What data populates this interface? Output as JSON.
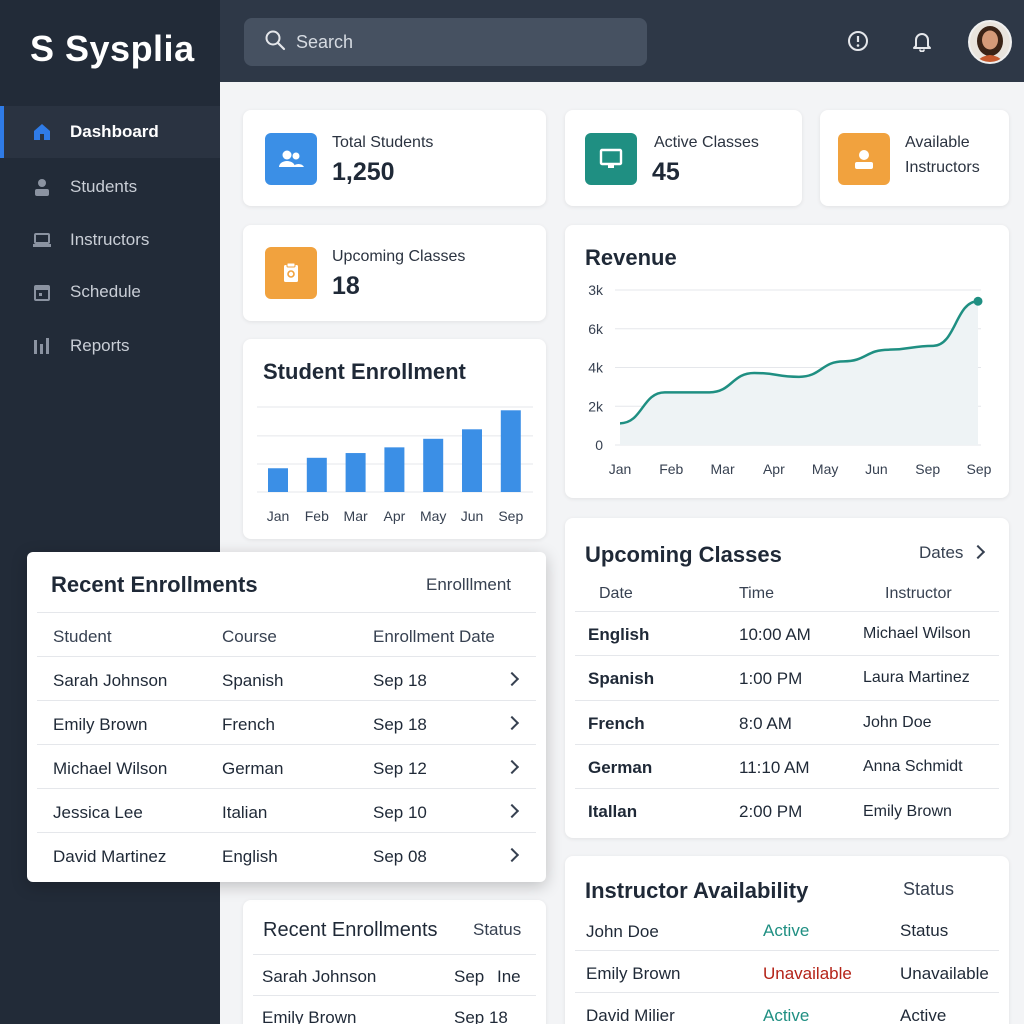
{
  "brand": "S Sysplia",
  "sidebar": {
    "items": [
      {
        "label": "Dashboard",
        "icon": "home-icon"
      },
      {
        "label": "Students",
        "icon": "user-icon"
      },
      {
        "label": "Instructors",
        "icon": "laptop-icon"
      },
      {
        "label": "Schedule",
        "icon": "calendar-icon"
      },
      {
        "label": "Reports",
        "icon": "bar-chart-icon"
      }
    ]
  },
  "header": {
    "search_placeholder": "Search"
  },
  "stats": {
    "total_students": {
      "label": "Total Students",
      "value": "1,250",
      "color": "#3b8fe6"
    },
    "active_classes": {
      "label": "Active Classes",
      "value": "45",
      "color": "#1f8f82"
    },
    "available_instructors": {
      "label_1": "Available",
      "label_2": "Instructors",
      "color": "#f1a23e"
    },
    "upcoming_classes": {
      "label": "Upcoming Classes",
      "value": "18",
      "color": "#f1a23e"
    }
  },
  "enrollment_chart": {
    "title": "Student Enrollment"
  },
  "revenue_chart": {
    "title": "Revenue"
  },
  "chart_data": [
    {
      "type": "bar",
      "title": "Student Enrollment",
      "categories": [
        "Jan",
        "Feb",
        "Mar",
        "Apr",
        "May",
        "Jun",
        "Sep"
      ],
      "values": [
        25,
        36,
        41,
        47,
        56,
        66,
        86
      ],
      "ylim": [
        0,
        100
      ],
      "color": "#3b8fe6",
      "grid": true
    },
    {
      "type": "area",
      "title": "Revenue",
      "categories": [
        "Jan",
        "Feb",
        "Mar",
        "Apr",
        "May",
        "Jun",
        "Sep",
        "Sep"
      ],
      "y_tick_labels": [
        "3k",
        "6k",
        "4k",
        "2k",
        "0"
      ],
      "values": [
        0.5,
        2.1,
        2.1,
        3.1,
        2.9,
        3.7,
        4.3,
        4.5,
        6.8
      ],
      "ylim": [
        0,
        8
      ],
      "color": "#1f8f82",
      "grid": true
    }
  ],
  "recent_enrollments": {
    "title": "Recent Enrollments",
    "side": "Enrolllment",
    "columns": [
      "Student",
      "Course",
      "Enrollment Date"
    ],
    "rows": [
      {
        "student": "Sarah Johnson",
        "course": "Spanish",
        "date": "Sep 18"
      },
      {
        "student": "Emily Brown",
        "course": "French",
        "date": "Sep 18"
      },
      {
        "student": "Michael Wilson",
        "course": "German",
        "date": "Sep 12"
      },
      {
        "student": "Jessica Lee",
        "course": "Italian",
        "date": "Sep 10"
      },
      {
        "student": "David Martinez",
        "course": "English",
        "date": "Sep 08"
      }
    ]
  },
  "recent_enrollments_2": {
    "title": "Recent Enrollments",
    "side": "Status",
    "rows": [
      {
        "name": "Sarah Johnson",
        "c1": "Sep",
        "c2": "Ine"
      },
      {
        "name": "Emily Brown",
        "c1": "Sep 18",
        "c2": ""
      }
    ]
  },
  "upcoming_classes": {
    "title": "Upcoming Classes",
    "side": "Dates",
    "columns": [
      "Date",
      "Time",
      "Instructor"
    ],
    "rows": [
      {
        "course": "English",
        "time": "10:00 AM",
        "instructor": "Michael Wilson"
      },
      {
        "course": "Spanish",
        "time": "1:00 PM",
        "instructor": "Laura Martinez"
      },
      {
        "course": "French",
        "time": "8:0 AM",
        "instructor": "John Doe"
      },
      {
        "course": "German",
        "time": "11:10 AM",
        "instructor": "Anna Schmidt"
      },
      {
        "course": "Itallan",
        "time": "2:00 PM",
        "instructor": "Emily Brown"
      }
    ]
  },
  "instructor_availability": {
    "title": "Instructor Availability",
    "side": "Status",
    "status_colors": {
      "active": "#1f8f82",
      "unavailable": "#b42318"
    },
    "rows": [
      {
        "name": "John Doe",
        "status": "Active",
        "kind": "active",
        "extra": "Status"
      },
      {
        "name": "Emily Brown",
        "status": "Unavailable",
        "kind": "unavailable",
        "extra": "Unavailable"
      },
      {
        "name": "David Milier",
        "status": "Active",
        "kind": "active",
        "extra": "Active"
      }
    ]
  }
}
